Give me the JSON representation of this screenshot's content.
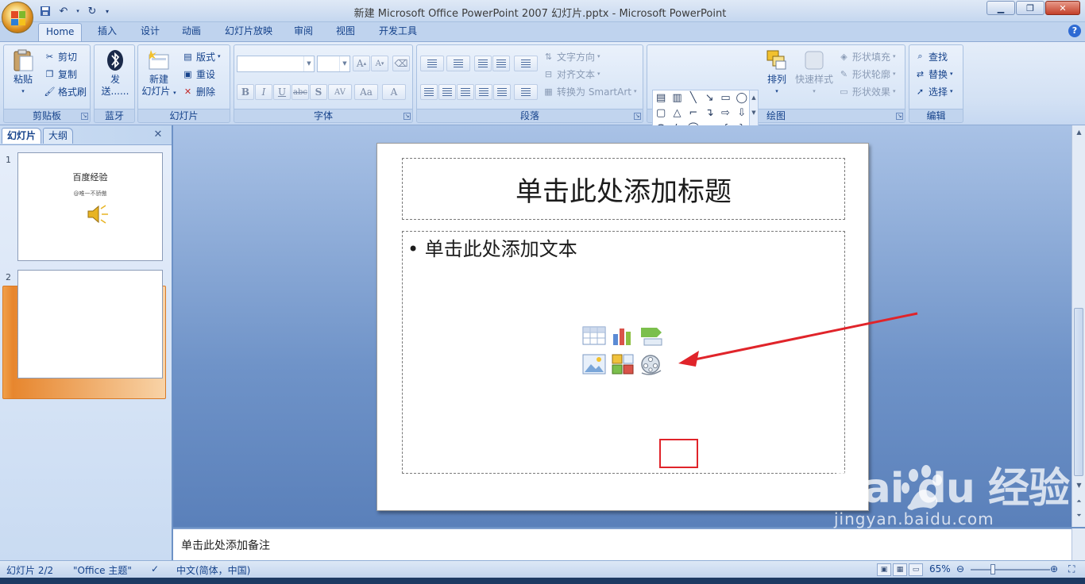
{
  "window": {
    "title": "新建 Microsoft Office PowerPoint 2007 幻灯片.pptx - Microsoft PowerPoint"
  },
  "ribbon_tabs": [
    "Home",
    "插入",
    "设计",
    "动画",
    "幻灯片放映",
    "审阅",
    "视图",
    "开发工具"
  ],
  "clipboard": {
    "paste": "粘贴",
    "cut": "剪切",
    "copy": "复制",
    "format_painter": "格式刷",
    "label": "剪贴板"
  },
  "bluetooth": {
    "send_line1": "发",
    "send_line2": "送......",
    "label": "蓝牙"
  },
  "slides_group": {
    "new_slide_line1": "新建",
    "new_slide_line2": "幻灯片",
    "layout": "版式",
    "reset": "重设",
    "delete": "删除",
    "label": "幻灯片"
  },
  "font_group": {
    "label": "字体",
    "bold": "B",
    "italic": "I",
    "underline": "U",
    "strike": "abc",
    "shadow": "S",
    "spacing": "AV",
    "case": "Aa",
    "color": "A",
    "grow": "A",
    "shrink": "A"
  },
  "paragraph_group": {
    "text_direction": "文字方向",
    "align_text": "对齐文本",
    "convert_smartart": "转换为 SmartArt",
    "label": "段落"
  },
  "drawing_group": {
    "arrange": "排列",
    "quick_styles": "快速样式",
    "shape_fill": "形状填充",
    "shape_outline": "形状轮廓",
    "shape_effects": "形状效果",
    "label": "绘图"
  },
  "editing_group": {
    "find": "查找",
    "replace": "替换",
    "select": "选择",
    "label": "编辑"
  },
  "panel_tabs": {
    "slides": "幻灯片",
    "outline": "大纲"
  },
  "thumbnails": [
    {
      "number": "1",
      "title": "百度经验",
      "subtitle": "@唯一不骄傲"
    },
    {
      "number": "2"
    }
  ],
  "slide": {
    "title_placeholder": "单击此处添加标题",
    "content_placeholder": "单击此处添加文本"
  },
  "notes": {
    "placeholder": "单击此处添加备注"
  },
  "status": {
    "slide_count": "幻灯片 2/2",
    "theme": "\"Office 主题\"",
    "language": "中文(简体，中国)",
    "zoom": "65%"
  },
  "watermark": {
    "logo": "Bai du 经验",
    "url": "jingyan.baidu.com"
  },
  "colors": {
    "highlight": "#e0242a",
    "accent": "#15428b"
  }
}
